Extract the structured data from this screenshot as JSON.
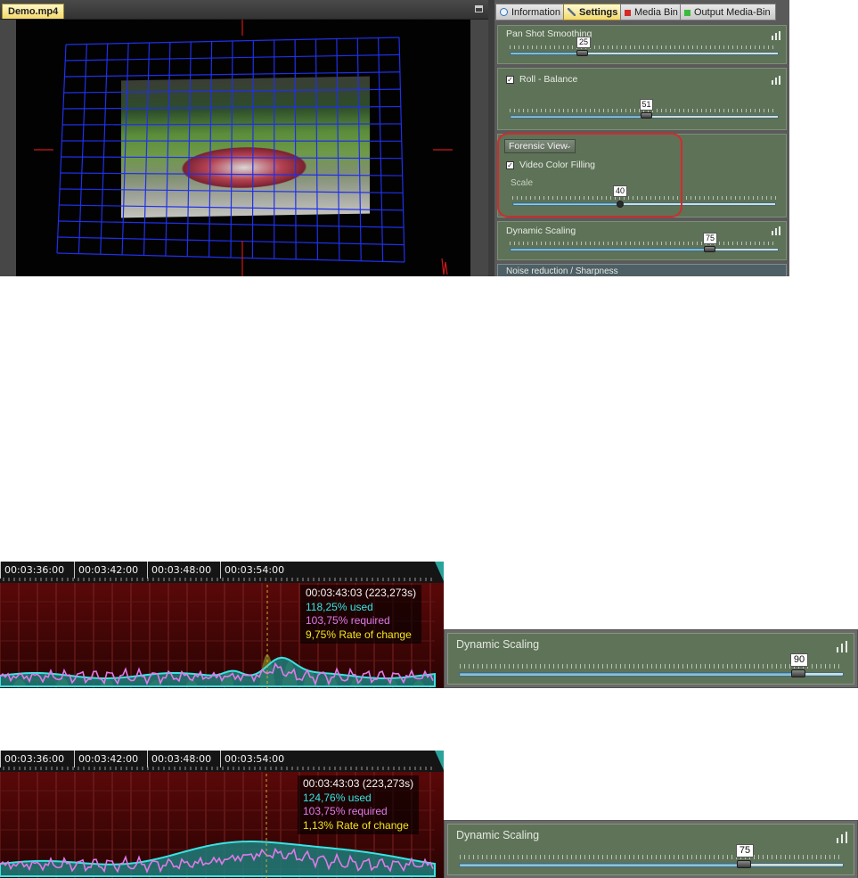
{
  "viewer": {
    "file_tab": "Demo.mp4",
    "grid_color": "#2030e8",
    "crosshair_color": "#d01818"
  },
  "panel": {
    "tabs": [
      {
        "label": "Information",
        "icon": "speech-bubble-icon"
      },
      {
        "label": "Settings",
        "icon": "wrench-icon",
        "active": true
      },
      {
        "label": "Media Bin",
        "icon": "red-square-icon"
      },
      {
        "label": "Output Media-Bin",
        "icon": "green-square-icon"
      }
    ],
    "pan_shot": {
      "label": "Pan Shot Smoothing",
      "value": "25",
      "value_num": 25
    },
    "roll": {
      "label": "Roll - Balance",
      "value": "51",
      "value_num": 51,
      "checked": true
    },
    "forensic": {
      "dropdown": "Forensic View",
      "checkbox_label": "Video Color Filling",
      "scale_label": "Scale",
      "value": "40",
      "value_num": 40,
      "checked": true
    },
    "dynamic": {
      "label": "Dynamic Scaling",
      "value": "75",
      "value_num": 75
    },
    "noise": {
      "label": "Noise reduction / Sharpness"
    }
  },
  "graph1": {
    "timestamps": [
      "00:03:36:00",
      "00:03:42:00",
      "00:03:48:00",
      "00:03:54:00"
    ],
    "readout": {
      "time": "00:03:43:03 (223,273s)",
      "used": "118,25% used",
      "required": "103,75% required",
      "rate": "9,75% Rate of change"
    }
  },
  "graph2": {
    "timestamps": [
      "00:03:36:00",
      "00:03:42:00",
      "00:03:48:00",
      "00:03:54:00"
    ],
    "readout": {
      "time": "00:03:43:03 (223,273s)",
      "used": "124,76% used",
      "required": "103,75% required",
      "rate": "1,13% Rate of change"
    }
  },
  "ds_widget1": {
    "label": "Dynamic Scaling",
    "value": "90",
    "value_num": 90
  },
  "ds_widget2": {
    "label": "Dynamic Scaling",
    "value": "75",
    "value_num": 75
  },
  "colors": {
    "used": "#37e4e4",
    "required": "#e07ae8",
    "rate": "#f5e620",
    "panel_green": "#5e7258",
    "highlight": "#d22b2b"
  }
}
